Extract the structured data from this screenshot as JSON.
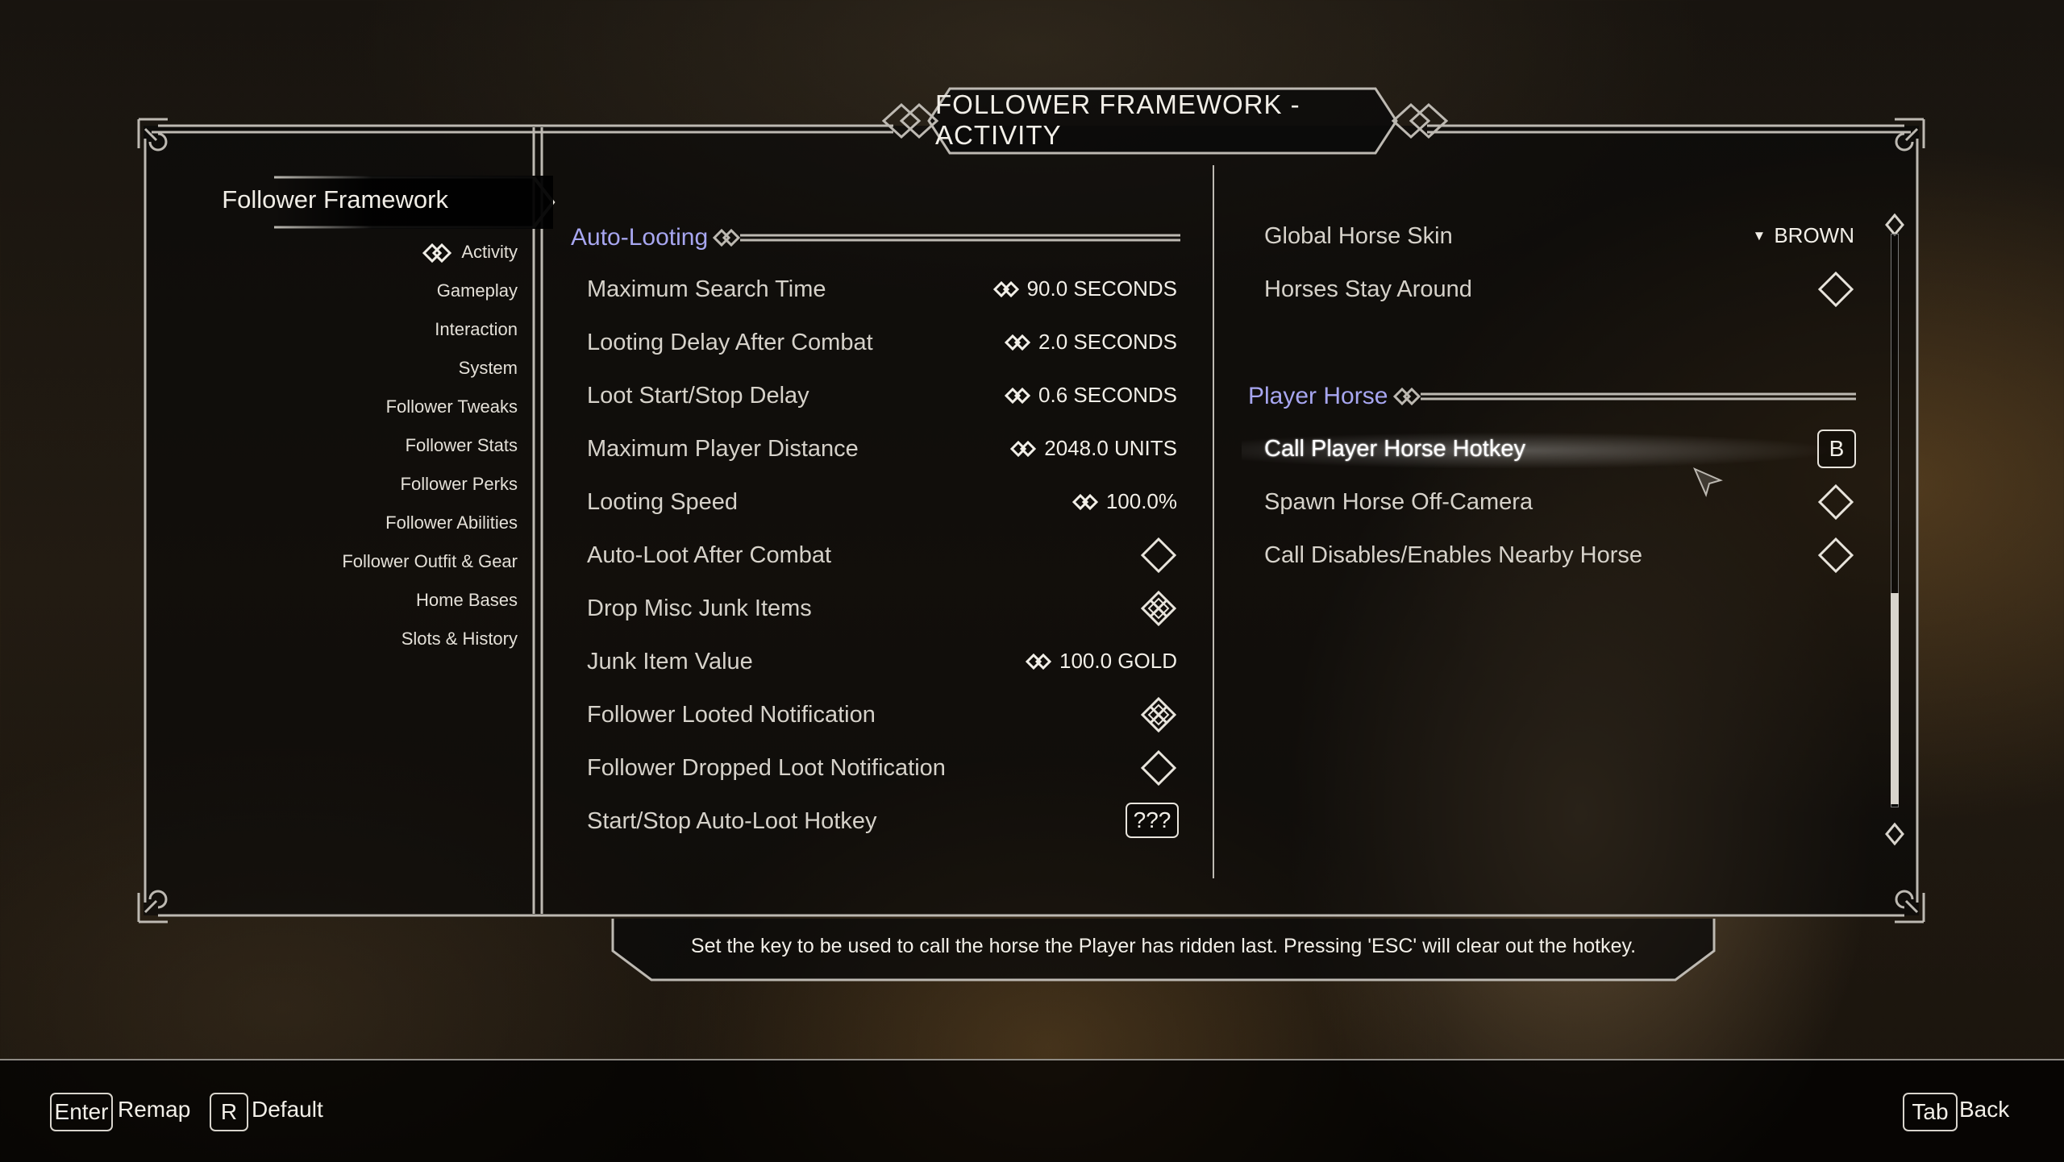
{
  "window": {
    "title": "FOLLOWER FRAMEWORK - ACTIVITY"
  },
  "sidebar": {
    "mod_name": "Follower Framework",
    "items": [
      {
        "label": "Activity",
        "active": true
      },
      {
        "label": "Gameplay"
      },
      {
        "label": "Interaction"
      },
      {
        "label": "System"
      },
      {
        "label": "Follower Tweaks"
      },
      {
        "label": "Follower Stats"
      },
      {
        "label": "Follower Perks"
      },
      {
        "label": "Follower Abilities"
      },
      {
        "label": "Follower Outfit & Gear"
      },
      {
        "label": "Home Bases"
      },
      {
        "label": "Slots & History"
      }
    ]
  },
  "left_column": {
    "header": "Auto-Looting",
    "options": [
      {
        "label": "Maximum Search Time",
        "type": "slider",
        "value": "90.0 SECONDS"
      },
      {
        "label": "Looting Delay After Combat",
        "type": "slider",
        "value": "2.0 SECONDS"
      },
      {
        "label": "Loot Start/Stop Delay",
        "type": "slider",
        "value": "0.6 SECONDS"
      },
      {
        "label": "Maximum Player Distance",
        "type": "slider",
        "value": "2048.0 UNITS"
      },
      {
        "label": "Looting Speed",
        "type": "slider",
        "value": "100.0%"
      },
      {
        "label": "Auto-Loot After Combat",
        "type": "toggle",
        "checked": false
      },
      {
        "label": "Drop Misc Junk Items",
        "type": "toggle",
        "checked": true
      },
      {
        "label": "Junk Item Value",
        "type": "slider",
        "value": "100.0 GOLD"
      },
      {
        "label": "Follower Looted Notification",
        "type": "toggle",
        "checked": true
      },
      {
        "label": "Follower Dropped Loot Notification",
        "type": "toggle",
        "checked": false
      },
      {
        "label": "Start/Stop Auto-Loot Hotkey",
        "type": "keymap",
        "value": "???"
      }
    ]
  },
  "right_column": {
    "top_options": [
      {
        "label": "Global Horse Skin",
        "type": "dropdown",
        "value": "BROWN"
      },
      {
        "label": "Horses Stay Around",
        "type": "toggle",
        "checked": false
      }
    ],
    "header": "Player Horse",
    "options": [
      {
        "label": "Call Player Horse Hotkey",
        "type": "keymap",
        "value": "B",
        "highlighted": true
      },
      {
        "label": "Spawn Horse Off-Camera",
        "type": "toggle",
        "checked": false
      },
      {
        "label": "Call Disables/Enables Nearby Horse",
        "type": "toggle",
        "checked": false
      }
    ]
  },
  "description": "Set the key to be used to call the horse the Player has ridden last. Pressing 'ESC' will clear out the hotkey.",
  "bottom_bar": {
    "remap": {
      "key": "Enter",
      "label": "Remap"
    },
    "default": {
      "key": "R",
      "label": "Default"
    },
    "back": {
      "key": "Tab",
      "label": "Back"
    }
  },
  "colors": {
    "accent": "#a7a6f0",
    "text": "#d6d2ca",
    "frame": "#bdb9b2"
  },
  "icons": {
    "slider": "double-diamond-icon",
    "toggle_off": "diamond-outline-icon",
    "toggle_on": "diamond-checked-icon",
    "dropdown": "triangle-down-icon",
    "section_ornament": "knot-ornament-icon"
  }
}
